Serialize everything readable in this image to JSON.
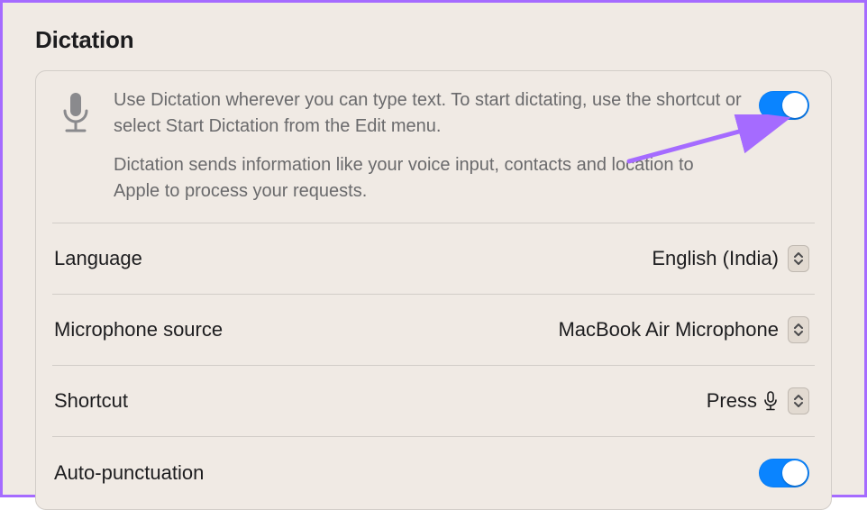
{
  "section_title": "Dictation",
  "intro": {
    "desc": "Use Dictation wherever you can type text. To start dictating, use the shortcut or select Start Dictation from the Edit menu.",
    "privacy": "Dictation sends information like your voice input, contacts and location to Apple to process your requests.",
    "toggle_on": true
  },
  "rows": {
    "language": {
      "label": "Language",
      "value": "English (India)"
    },
    "mic_source": {
      "label": "Microphone source",
      "value": "MacBook Air Microphone"
    },
    "shortcut": {
      "label": "Shortcut",
      "value_prefix": "Press"
    },
    "auto_punct": {
      "label": "Auto-punctuation",
      "toggle_on": true
    }
  },
  "icons": {
    "microphone": "microphone-icon",
    "updown": "updown-icon"
  },
  "colors": {
    "accent": "#0a84ff",
    "annotation": "#a56bff"
  }
}
